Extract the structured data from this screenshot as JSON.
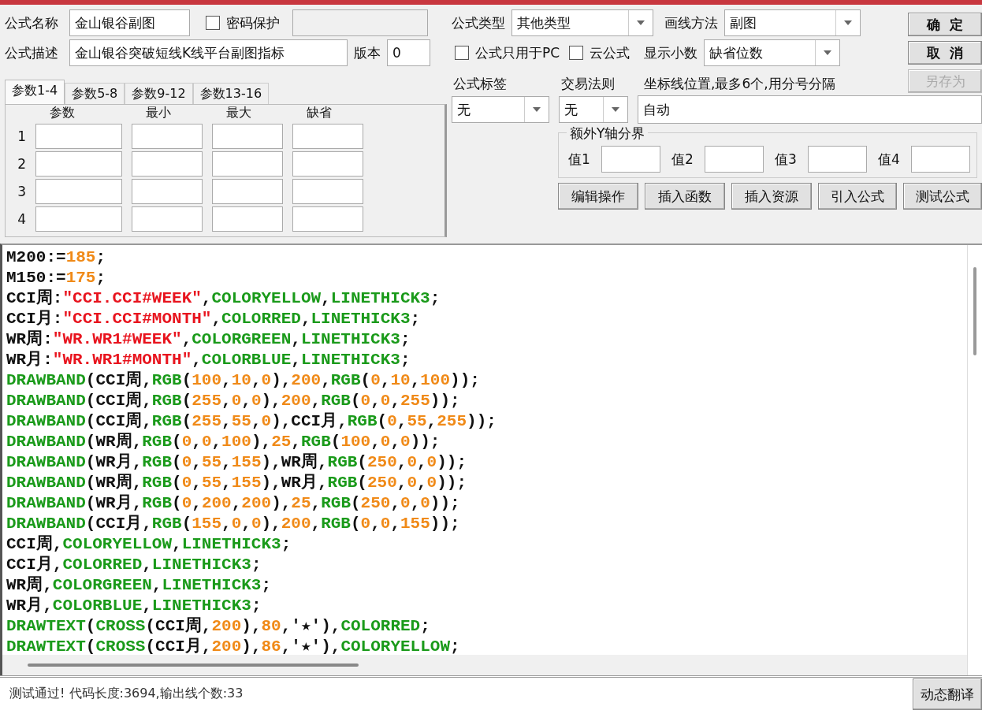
{
  "formula": {
    "name_label": "公式名称",
    "name": "金山银谷副图",
    "password": {
      "label": "密码保护",
      "checked": false
    },
    "desc_label": "公式描述",
    "desc": "金山银谷突破短线K线平台副图指标",
    "version_label": "版本",
    "version": "0"
  },
  "param_tabs": [
    {
      "label": "参数1-4",
      "selected": true
    },
    {
      "label": "参数5-8",
      "selected": false
    },
    {
      "label": "参数9-12",
      "selected": false
    },
    {
      "label": "参数13-16",
      "selected": false
    }
  ],
  "param_columns": [
    "参数",
    "最小",
    "最大",
    "缺省"
  ],
  "param_rows": [
    "1",
    "2",
    "3",
    "4"
  ],
  "formula_type": {
    "label": "公式类型",
    "value": "其他类型"
  },
  "draw_method": {
    "label": "画线方法",
    "value": "副图"
  },
  "pc_only": {
    "label": "公式只用于PC",
    "checked": false
  },
  "cloud": {
    "label": "云公式",
    "checked": false
  },
  "decimals": {
    "label": "显示小数",
    "value": "缺省位数"
  },
  "side_buttons": [
    {
      "label": "确  定",
      "disabled": false
    },
    {
      "label": "取  消",
      "disabled": false
    },
    {
      "label": "另存为",
      "disabled": true
    }
  ],
  "tag": {
    "label": "公式标签",
    "value": "无"
  },
  "trade_rule": {
    "label": "交易法则",
    "value": "无"
  },
  "axis_lines": {
    "label": "坐标线位置,最多6个,用分号分隔",
    "value": "自动"
  },
  "y_bounds": {
    "title": "额外Y轴分界",
    "fields": [
      "值1",
      "值2",
      "值3",
      "值4"
    ]
  },
  "action_buttons": [
    "编辑操作",
    "插入函数",
    "插入资源",
    "引入公式",
    "测试公式"
  ],
  "code_lines": [
    [
      {
        "kind": "plain",
        "text": "M200:="
      },
      {
        "kind": "number",
        "text": "185"
      },
      {
        "kind": "plain",
        "text": ";"
      }
    ],
    [
      {
        "kind": "plain",
        "text": "M150:="
      },
      {
        "kind": "number",
        "text": "175"
      },
      {
        "kind": "plain",
        "text": ";"
      }
    ],
    [
      {
        "kind": "plain",
        "text": "CCI周:"
      },
      {
        "kind": "string",
        "text": "\"CCI.CCI#WEEK\""
      },
      {
        "kind": "plain",
        "text": ","
      },
      {
        "kind": "keyword",
        "text": "COLORYELLOW"
      },
      {
        "kind": "plain",
        "text": ","
      },
      {
        "kind": "keyword",
        "text": "LINETHICK3"
      },
      {
        "kind": "plain",
        "text": ";"
      }
    ],
    [
      {
        "kind": "plain",
        "text": "CCI月:"
      },
      {
        "kind": "string",
        "text": "\"CCI.CCI#MONTH\""
      },
      {
        "kind": "plain",
        "text": ","
      },
      {
        "kind": "keyword",
        "text": "COLORRED"
      },
      {
        "kind": "plain",
        "text": ","
      },
      {
        "kind": "keyword",
        "text": "LINETHICK3"
      },
      {
        "kind": "plain",
        "text": ";"
      }
    ],
    [
      {
        "kind": "plain",
        "text": "WR周:"
      },
      {
        "kind": "string",
        "text": "\"WR.WR1#WEEK\""
      },
      {
        "kind": "plain",
        "text": ","
      },
      {
        "kind": "keyword",
        "text": "COLORGREEN"
      },
      {
        "kind": "plain",
        "text": ","
      },
      {
        "kind": "keyword",
        "text": "LINETHICK3"
      },
      {
        "kind": "plain",
        "text": ";"
      }
    ],
    [
      {
        "kind": "plain",
        "text": "WR月:"
      },
      {
        "kind": "string",
        "text": "\"WR.WR1#MONTH\""
      },
      {
        "kind": "plain",
        "text": ","
      },
      {
        "kind": "keyword",
        "text": "COLORBLUE"
      },
      {
        "kind": "plain",
        "text": ","
      },
      {
        "kind": "keyword",
        "text": "LINETHICK3"
      },
      {
        "kind": "plain",
        "text": ";"
      }
    ],
    [
      {
        "kind": "keyword",
        "text": "DRAWBAND"
      },
      {
        "kind": "plain",
        "text": "(CCI周,"
      },
      {
        "kind": "keyword",
        "text": "RGB"
      },
      {
        "kind": "plain",
        "text": "("
      },
      {
        "kind": "number",
        "text": "100"
      },
      {
        "kind": "plain",
        "text": ","
      },
      {
        "kind": "number",
        "text": "10"
      },
      {
        "kind": "plain",
        "text": ","
      },
      {
        "kind": "number",
        "text": "0"
      },
      {
        "kind": "plain",
        "text": "),"
      },
      {
        "kind": "number",
        "text": "200"
      },
      {
        "kind": "plain",
        "text": ","
      },
      {
        "kind": "keyword",
        "text": "RGB"
      },
      {
        "kind": "plain",
        "text": "("
      },
      {
        "kind": "number",
        "text": "0"
      },
      {
        "kind": "plain",
        "text": ","
      },
      {
        "kind": "number",
        "text": "10"
      },
      {
        "kind": "plain",
        "text": ","
      },
      {
        "kind": "number",
        "text": "100"
      },
      {
        "kind": "plain",
        "text": "));"
      }
    ],
    [
      {
        "kind": "keyword",
        "text": "DRAWBAND"
      },
      {
        "kind": "plain",
        "text": "(CCI周,"
      },
      {
        "kind": "keyword",
        "text": "RGB"
      },
      {
        "kind": "plain",
        "text": "("
      },
      {
        "kind": "number",
        "text": "255"
      },
      {
        "kind": "plain",
        "text": ","
      },
      {
        "kind": "number",
        "text": "0"
      },
      {
        "kind": "plain",
        "text": ","
      },
      {
        "kind": "number",
        "text": "0"
      },
      {
        "kind": "plain",
        "text": "),"
      },
      {
        "kind": "number",
        "text": "200"
      },
      {
        "kind": "plain",
        "text": ","
      },
      {
        "kind": "keyword",
        "text": "RGB"
      },
      {
        "kind": "plain",
        "text": "("
      },
      {
        "kind": "number",
        "text": "0"
      },
      {
        "kind": "plain",
        "text": ","
      },
      {
        "kind": "number",
        "text": "0"
      },
      {
        "kind": "plain",
        "text": ","
      },
      {
        "kind": "number",
        "text": "255"
      },
      {
        "kind": "plain",
        "text": "));"
      }
    ],
    [
      {
        "kind": "keyword",
        "text": "DRAWBAND"
      },
      {
        "kind": "plain",
        "text": "(CCI周,"
      },
      {
        "kind": "keyword",
        "text": "RGB"
      },
      {
        "kind": "plain",
        "text": "("
      },
      {
        "kind": "number",
        "text": "255"
      },
      {
        "kind": "plain",
        "text": ","
      },
      {
        "kind": "number",
        "text": "55"
      },
      {
        "kind": "plain",
        "text": ","
      },
      {
        "kind": "number",
        "text": "0"
      },
      {
        "kind": "plain",
        "text": "),CCI月,"
      },
      {
        "kind": "keyword",
        "text": "RGB"
      },
      {
        "kind": "plain",
        "text": "("
      },
      {
        "kind": "number",
        "text": "0"
      },
      {
        "kind": "plain",
        "text": ","
      },
      {
        "kind": "number",
        "text": "55"
      },
      {
        "kind": "plain",
        "text": ","
      },
      {
        "kind": "number",
        "text": "255"
      },
      {
        "kind": "plain",
        "text": "));"
      }
    ],
    [
      {
        "kind": "keyword",
        "text": "DRAWBAND"
      },
      {
        "kind": "plain",
        "text": "(WR周,"
      },
      {
        "kind": "keyword",
        "text": "RGB"
      },
      {
        "kind": "plain",
        "text": "("
      },
      {
        "kind": "number",
        "text": "0"
      },
      {
        "kind": "plain",
        "text": ","
      },
      {
        "kind": "number",
        "text": "0"
      },
      {
        "kind": "plain",
        "text": ","
      },
      {
        "kind": "number",
        "text": "100"
      },
      {
        "kind": "plain",
        "text": "),"
      },
      {
        "kind": "number",
        "text": "25"
      },
      {
        "kind": "plain",
        "text": ","
      },
      {
        "kind": "keyword",
        "text": "RGB"
      },
      {
        "kind": "plain",
        "text": "("
      },
      {
        "kind": "number",
        "text": "100"
      },
      {
        "kind": "plain",
        "text": ","
      },
      {
        "kind": "number",
        "text": "0"
      },
      {
        "kind": "plain",
        "text": ","
      },
      {
        "kind": "number",
        "text": "0"
      },
      {
        "kind": "plain",
        "text": "));"
      }
    ],
    [
      {
        "kind": "keyword",
        "text": "DRAWBAND"
      },
      {
        "kind": "plain",
        "text": "(WR月,"
      },
      {
        "kind": "keyword",
        "text": "RGB"
      },
      {
        "kind": "plain",
        "text": "("
      },
      {
        "kind": "number",
        "text": "0"
      },
      {
        "kind": "plain",
        "text": ","
      },
      {
        "kind": "number",
        "text": "55"
      },
      {
        "kind": "plain",
        "text": ","
      },
      {
        "kind": "number",
        "text": "155"
      },
      {
        "kind": "plain",
        "text": "),WR周,"
      },
      {
        "kind": "keyword",
        "text": "RGB"
      },
      {
        "kind": "plain",
        "text": "("
      },
      {
        "kind": "number",
        "text": "250"
      },
      {
        "kind": "plain",
        "text": ","
      },
      {
        "kind": "number",
        "text": "0"
      },
      {
        "kind": "plain",
        "text": ","
      },
      {
        "kind": "number",
        "text": "0"
      },
      {
        "kind": "plain",
        "text": "));"
      }
    ],
    [
      {
        "kind": "keyword",
        "text": "DRAWBAND"
      },
      {
        "kind": "plain",
        "text": "(WR周,"
      },
      {
        "kind": "keyword",
        "text": "RGB"
      },
      {
        "kind": "plain",
        "text": "("
      },
      {
        "kind": "number",
        "text": "0"
      },
      {
        "kind": "plain",
        "text": ","
      },
      {
        "kind": "number",
        "text": "55"
      },
      {
        "kind": "plain",
        "text": ","
      },
      {
        "kind": "number",
        "text": "155"
      },
      {
        "kind": "plain",
        "text": "),WR月,"
      },
      {
        "kind": "keyword",
        "text": "RGB"
      },
      {
        "kind": "plain",
        "text": "("
      },
      {
        "kind": "number",
        "text": "250"
      },
      {
        "kind": "plain",
        "text": ","
      },
      {
        "kind": "number",
        "text": "0"
      },
      {
        "kind": "plain",
        "text": ","
      },
      {
        "kind": "number",
        "text": "0"
      },
      {
        "kind": "plain",
        "text": "));"
      }
    ],
    [
      {
        "kind": "keyword",
        "text": "DRAWBAND"
      },
      {
        "kind": "plain",
        "text": "(WR月,"
      },
      {
        "kind": "keyword",
        "text": "RGB"
      },
      {
        "kind": "plain",
        "text": "("
      },
      {
        "kind": "number",
        "text": "0"
      },
      {
        "kind": "plain",
        "text": ","
      },
      {
        "kind": "number",
        "text": "200"
      },
      {
        "kind": "plain",
        "text": ","
      },
      {
        "kind": "number",
        "text": "200"
      },
      {
        "kind": "plain",
        "text": "),"
      },
      {
        "kind": "number",
        "text": "25"
      },
      {
        "kind": "plain",
        "text": ","
      },
      {
        "kind": "keyword",
        "text": "RGB"
      },
      {
        "kind": "plain",
        "text": "("
      },
      {
        "kind": "number",
        "text": "250"
      },
      {
        "kind": "plain",
        "text": ","
      },
      {
        "kind": "number",
        "text": "0"
      },
      {
        "kind": "plain",
        "text": ","
      },
      {
        "kind": "number",
        "text": "0"
      },
      {
        "kind": "plain",
        "text": "));"
      }
    ],
    [
      {
        "kind": "keyword",
        "text": "DRAWBAND"
      },
      {
        "kind": "plain",
        "text": "(CCI月,"
      },
      {
        "kind": "keyword",
        "text": "RGB"
      },
      {
        "kind": "plain",
        "text": "("
      },
      {
        "kind": "number",
        "text": "155"
      },
      {
        "kind": "plain",
        "text": ","
      },
      {
        "kind": "number",
        "text": "0"
      },
      {
        "kind": "plain",
        "text": ","
      },
      {
        "kind": "number",
        "text": "0"
      },
      {
        "kind": "plain",
        "text": "),"
      },
      {
        "kind": "number",
        "text": "200"
      },
      {
        "kind": "plain",
        "text": ","
      },
      {
        "kind": "keyword",
        "text": "RGB"
      },
      {
        "kind": "plain",
        "text": "("
      },
      {
        "kind": "number",
        "text": "0"
      },
      {
        "kind": "plain",
        "text": ","
      },
      {
        "kind": "number",
        "text": "0"
      },
      {
        "kind": "plain",
        "text": ","
      },
      {
        "kind": "number",
        "text": "155"
      },
      {
        "kind": "plain",
        "text": "));"
      }
    ],
    [
      {
        "kind": "plain",
        "text": "CCI周,"
      },
      {
        "kind": "keyword",
        "text": "COLORYELLOW"
      },
      {
        "kind": "plain",
        "text": ","
      },
      {
        "kind": "keyword",
        "text": "LINETHICK3"
      },
      {
        "kind": "plain",
        "text": ";"
      }
    ],
    [
      {
        "kind": "plain",
        "text": "CCI月,"
      },
      {
        "kind": "keyword",
        "text": "COLORRED"
      },
      {
        "kind": "plain",
        "text": ","
      },
      {
        "kind": "keyword",
        "text": "LINETHICK3"
      },
      {
        "kind": "plain",
        "text": ";"
      }
    ],
    [
      {
        "kind": "plain",
        "text": "WR周,"
      },
      {
        "kind": "keyword",
        "text": "COLORGREEN"
      },
      {
        "kind": "plain",
        "text": ","
      },
      {
        "kind": "keyword",
        "text": "LINETHICK3"
      },
      {
        "kind": "plain",
        "text": ";"
      }
    ],
    [
      {
        "kind": "plain",
        "text": "WR月,"
      },
      {
        "kind": "keyword",
        "text": "COLORBLUE"
      },
      {
        "kind": "plain",
        "text": ","
      },
      {
        "kind": "keyword",
        "text": "LINETHICK3"
      },
      {
        "kind": "plain",
        "text": ";"
      }
    ],
    [
      {
        "kind": "keyword",
        "text": "DRAWTEXT"
      },
      {
        "kind": "plain",
        "text": "("
      },
      {
        "kind": "keyword",
        "text": "CROSS"
      },
      {
        "kind": "plain",
        "text": "(CCI周,"
      },
      {
        "kind": "number",
        "text": "200"
      },
      {
        "kind": "plain",
        "text": "),"
      },
      {
        "kind": "number",
        "text": "80"
      },
      {
        "kind": "plain",
        "text": ",'★'),"
      },
      {
        "kind": "keyword",
        "text": "COLORRED"
      },
      {
        "kind": "plain",
        "text": ";"
      }
    ],
    [
      {
        "kind": "keyword",
        "text": "DRAWTEXT"
      },
      {
        "kind": "plain",
        "text": "("
      },
      {
        "kind": "keyword",
        "text": "CROSS"
      },
      {
        "kind": "plain",
        "text": "(CCI月,"
      },
      {
        "kind": "number",
        "text": "200"
      },
      {
        "kind": "plain",
        "text": "),"
      },
      {
        "kind": "number",
        "text": "86"
      },
      {
        "kind": "plain",
        "text": ",'★'),"
      },
      {
        "kind": "keyword",
        "text": "COLORYELLOW"
      },
      {
        "kind": "plain",
        "text": ";"
      }
    ]
  ],
  "status": "测试通过! 代码长度:3694,输出线个数:33",
  "translate_button": "动态翻译"
}
